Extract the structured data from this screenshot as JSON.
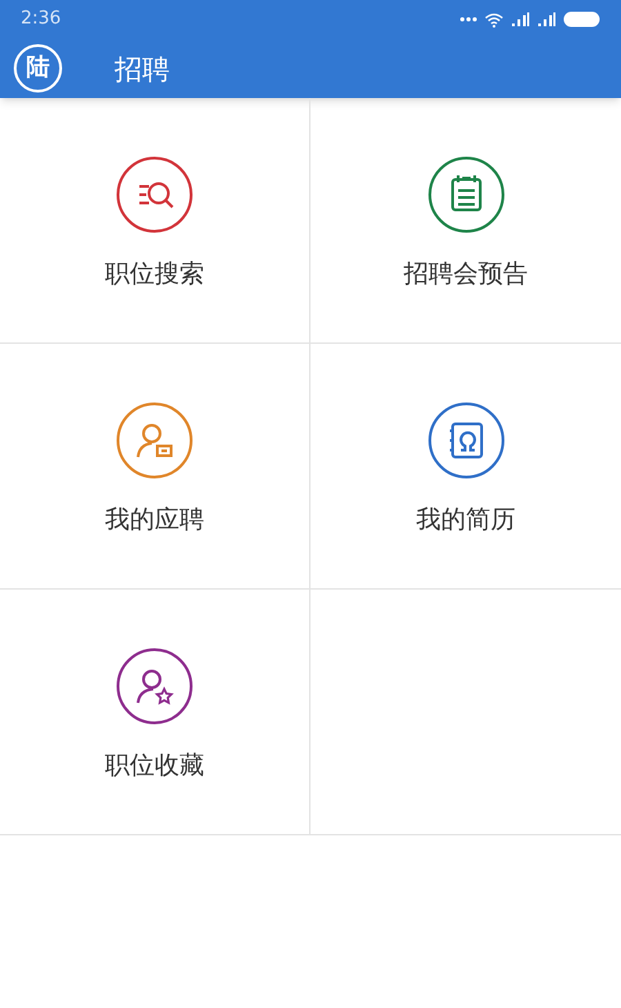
{
  "status_bar": {
    "time": "2:36"
  },
  "app_bar": {
    "avatar": "陆",
    "title": "招聘"
  },
  "menu": [
    {
      "label": "职位搜索",
      "kind": "search",
      "color": "#d2343a"
    },
    {
      "label": "招聘会预告",
      "kind": "calendar",
      "color": "#1e8449"
    },
    {
      "label": "我的应聘",
      "kind": "applicant",
      "color": "#e0862a"
    },
    {
      "label": "我的简历",
      "kind": "resume",
      "color": "#2f6fc8"
    },
    {
      "label": "职位收藏",
      "kind": "favorite",
      "color": "#8e2d8e"
    }
  ]
}
